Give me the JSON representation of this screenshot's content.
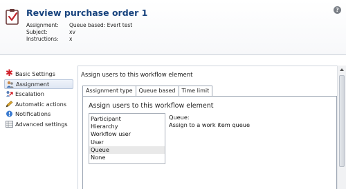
{
  "header": {
    "title": "Review purchase order 1",
    "fields": [
      {
        "label": "Assignment:",
        "value": "Queue based: Evert test"
      },
      {
        "label": "Subject:",
        "value": "xv"
      },
      {
        "label": "Instructions:",
        "value": "x"
      }
    ],
    "help": "?"
  },
  "nav": {
    "items": [
      {
        "label": "Basic Settings",
        "icon": "red-asterisk-icon"
      },
      {
        "label": "Assignment",
        "icon": "user-assignment-icon",
        "selected": true
      },
      {
        "label": "Escalation",
        "icon": "escalation-arrow-icon"
      },
      {
        "label": "Automatic actions",
        "icon": "pencil-icon"
      },
      {
        "label": "Notifications",
        "icon": "notification-icon"
      },
      {
        "label": "Advanced settings",
        "icon": "settings-grid-icon"
      }
    ]
  },
  "main": {
    "heading": "Assign users to this workflow element",
    "tabs": [
      {
        "label": "Assignment type",
        "active": true
      },
      {
        "label": "Queue based"
      },
      {
        "label": "Time limit"
      }
    ],
    "panel_heading": "Assign users to this workflow element",
    "options": [
      "Participant",
      "Hierarchy",
      "Workflow user",
      "User",
      "Queue",
      "None"
    ],
    "selected_option": "Queue",
    "description": {
      "title": "Queue:",
      "text": "Assign to a work item queue"
    }
  },
  "colors": {
    "title": "#16427d",
    "asterisk": "#d0202a",
    "selection": "#e9e9e9"
  }
}
